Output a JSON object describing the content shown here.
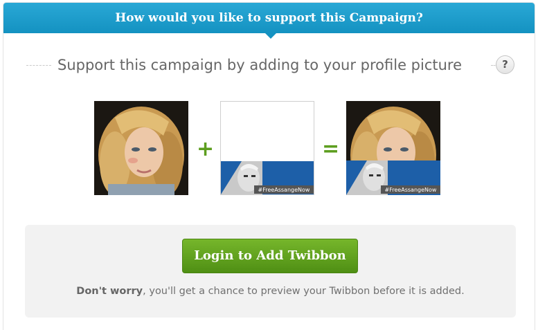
{
  "header": {
    "title": "How would you like to support this Campaign?"
  },
  "section": {
    "subtitle": "Support this campaign by adding to your profile picture",
    "help_label": "?"
  },
  "images": {
    "twibbon_tag": "#FreeAssangeNow",
    "operators": {
      "plus": "+",
      "equals": "="
    }
  },
  "login": {
    "button_label": "Login to Add Twibbon",
    "note_bold": "Don't worry",
    "note_rest": ", you'll get a chance to preview your Twibbon before it is added."
  },
  "colors": {
    "header": "#1a9bcb",
    "button": "#5d9e1f",
    "panel": "#f2f2f2"
  }
}
